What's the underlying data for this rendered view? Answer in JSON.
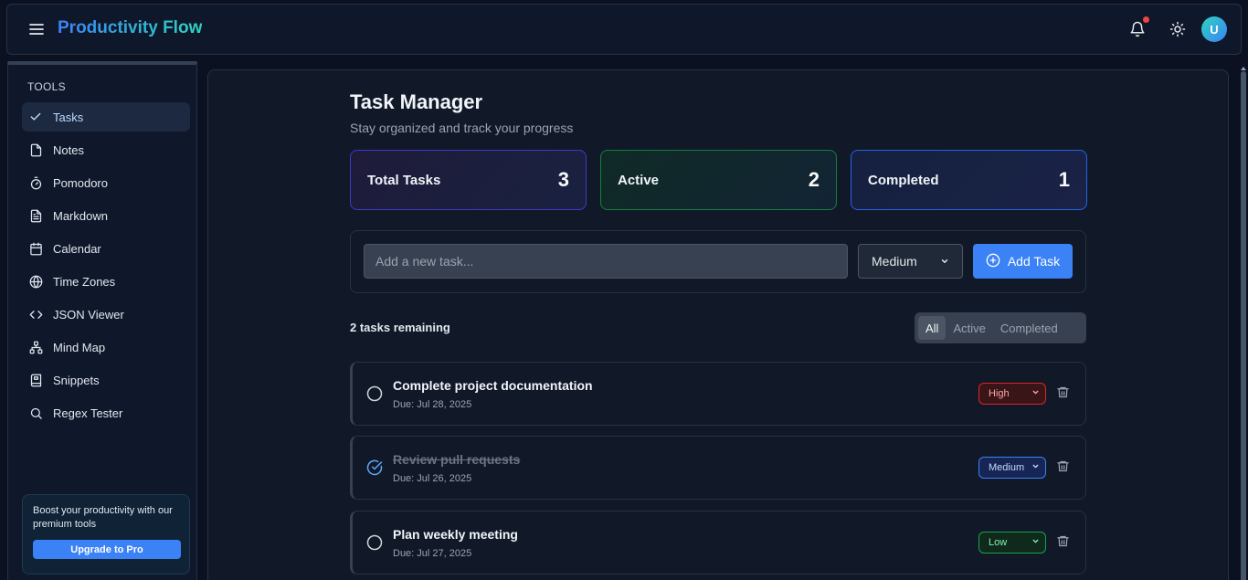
{
  "header": {
    "brand": "Productivity Flow",
    "avatar_initial": "U"
  },
  "sidebar": {
    "section_title": "TOOLS",
    "items": [
      {
        "label": "Tasks",
        "icon": "check-icon",
        "active": true
      },
      {
        "label": "Notes",
        "icon": "file-icon"
      },
      {
        "label": "Pomodoro",
        "icon": "timer-icon"
      },
      {
        "label": "Markdown",
        "icon": "document-icon"
      },
      {
        "label": "Calendar",
        "icon": "calendar-icon"
      },
      {
        "label": "Time Zones",
        "icon": "globe-icon"
      },
      {
        "label": "JSON Viewer",
        "icon": "code-icon"
      },
      {
        "label": "Mind Map",
        "icon": "network-icon"
      },
      {
        "label": "Snippets",
        "icon": "book-icon"
      },
      {
        "label": "Regex Tester",
        "icon": "search-icon"
      }
    ],
    "promo": {
      "text": "Boost your productivity with our premium tools",
      "button": "Upgrade to Pro"
    }
  },
  "main": {
    "title": "Task Manager",
    "subtitle": "Stay organized and track your progress",
    "stats": {
      "total_label": "Total Tasks",
      "total_value": "3",
      "active_label": "Active",
      "active_value": "2",
      "completed_label": "Completed",
      "completed_value": "1"
    },
    "add_task": {
      "placeholder": "Add a new task...",
      "priority": "Medium",
      "button": "Add Task"
    },
    "remaining": "2 tasks remaining",
    "filters": [
      "All",
      "Active",
      "Completed"
    ],
    "tasks": [
      {
        "title": "Complete project documentation",
        "due": "Due: Jul 28, 2025",
        "priority": "High",
        "done": false
      },
      {
        "title": "Review pull requests",
        "due": "Due: Jul 26, 2025",
        "priority": "Medium",
        "done": true
      },
      {
        "title": "Plan weekly meeting",
        "due": "Due: Jul 27, 2025",
        "priority": "Low",
        "done": false
      }
    ]
  },
  "colors": {
    "accent": "#3b82f6",
    "background": "#0b1120",
    "high": "#dc2626",
    "medium": "#3b82f6",
    "low": "#16a34a"
  }
}
